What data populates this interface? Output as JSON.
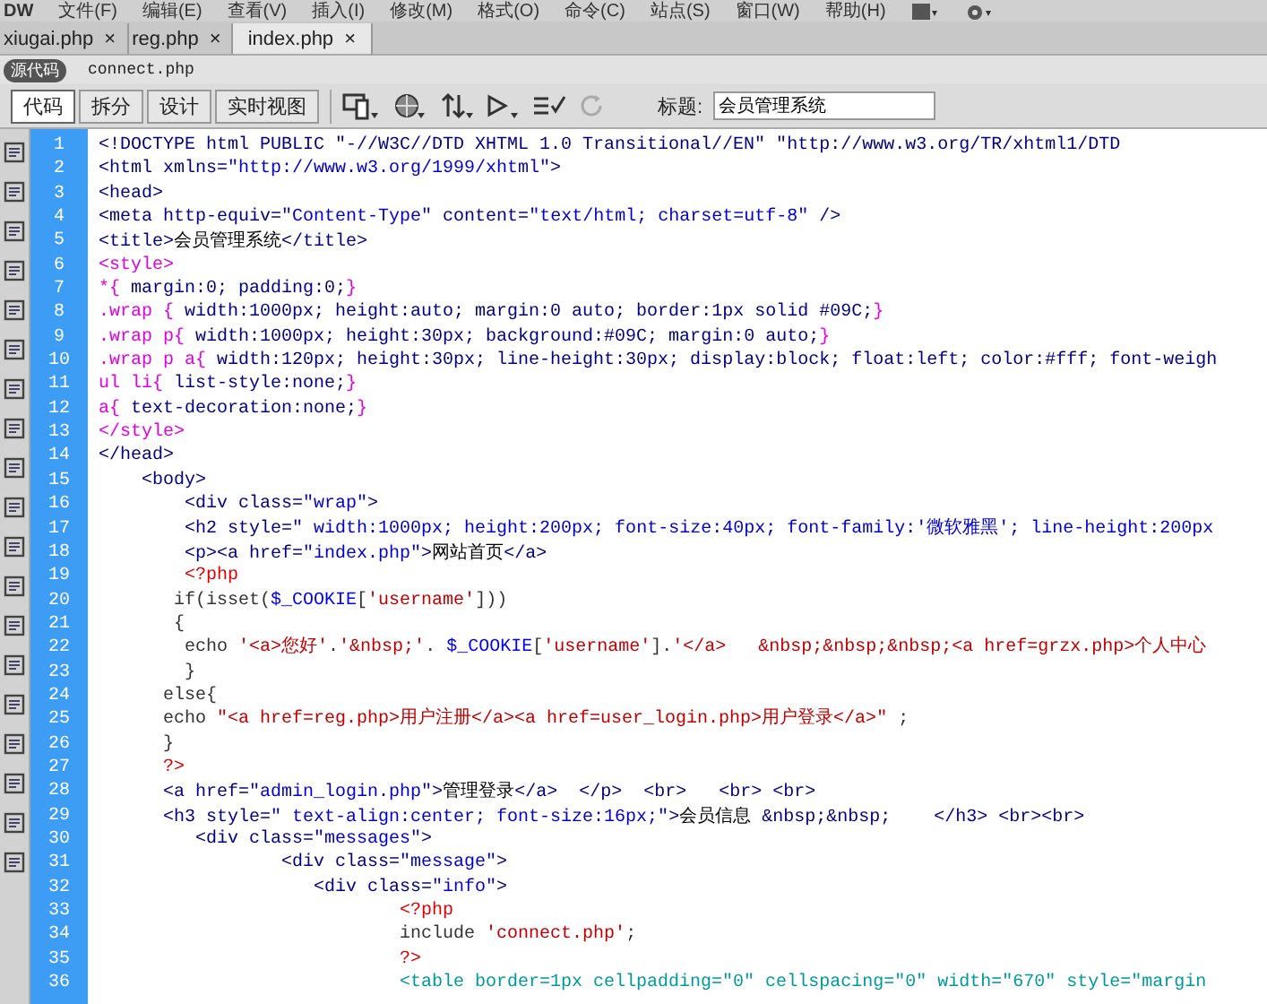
{
  "menu_bar": {
    "logo": "DW",
    "items": [
      "文件(F)",
      "编辑(E)",
      "查看(V)",
      "插入(I)",
      "修改(M)",
      "格式(O)",
      "命令(C)",
      "站点(S)",
      "窗口(W)",
      "帮助(H)"
    ]
  },
  "tabs": [
    {
      "label": "xiugai.php",
      "close": "×",
      "selected": false
    },
    {
      "label": "reg.php",
      "close": "×",
      "selected": false
    },
    {
      "label": "index.php",
      "close": "×",
      "selected": true
    }
  ],
  "related_files": [
    {
      "label": "源代码",
      "selected": true
    },
    {
      "label": "connect.php",
      "selected": false
    }
  ],
  "toolbar": {
    "views": [
      {
        "label": "代码",
        "selected": true
      },
      {
        "label": "拆分",
        "selected": false
      },
      {
        "label": "设计",
        "selected": false
      },
      {
        "label": "实时视图",
        "selected": false
      }
    ],
    "title_label": "标题:",
    "title_value": "会员管理系统"
  },
  "code": [
    {
      "number": "1",
      "segments": [
        {
          "kind": "tag",
          "text": "<!DOCTYPE html PUBLIC \"-//W3C//DTD XHTML 1.0 Transitional//EN\" \"http://www.w3.org/TR/xhtml1/DTD"
        }
      ]
    },
    {
      "number": "2",
      "segments": [
        {
          "kind": "tag",
          "text": "<html xmlns="
        },
        {
          "kind": "value",
          "text": "\"http://www.w3.org/1999/xhtml\""
        },
        {
          "kind": "tag",
          "text": ">"
        }
      ]
    },
    {
      "number": "3",
      "segments": [
        {
          "kind": "tag",
          "text": "<head>"
        }
      ]
    },
    {
      "number": "4",
      "segments": [
        {
          "kind": "tag",
          "text": "<meta http-equiv="
        },
        {
          "kind": "value",
          "text": "\"Content-Type\""
        },
        {
          "kind": "tag",
          "text": " content="
        },
        {
          "kind": "value",
          "text": "\"text/html; charset=utf-8\""
        },
        {
          "kind": "tag",
          "text": " />"
        }
      ]
    },
    {
      "number": "5",
      "segments": [
        {
          "kind": "tag",
          "text": "<title>"
        },
        {
          "kind": "text",
          "text": "会员管理系统"
        },
        {
          "kind": "tag",
          "text": "</title>"
        }
      ]
    },
    {
      "number": "6",
      "segments": [
        {
          "kind": "selector",
          "text": "<style>"
        }
      ]
    },
    {
      "number": "7",
      "segments": [
        {
          "kind": "selector",
          "text": "*{"
        },
        {
          "kind": "css",
          "text": " margin:0; padding:0;"
        },
        {
          "kind": "selector",
          "text": "}"
        }
      ]
    },
    {
      "number": "8",
      "segments": [
        {
          "kind": "selector",
          "text": ".wrap {"
        },
        {
          "kind": "css",
          "text": " width:1000px; height:auto; margin:0 auto; border:1px solid #09C;"
        },
        {
          "kind": "selector",
          "text": "}"
        }
      ]
    },
    {
      "number": "9",
      "segments": [
        {
          "kind": "selector",
          "text": ".wrap p{"
        },
        {
          "kind": "css",
          "text": " width:1000px; height:30px; background:#09C; margin:0 auto;"
        },
        {
          "kind": "selector",
          "text": "}"
        }
      ]
    },
    {
      "number": "10",
      "segments": [
        {
          "kind": "selector",
          "text": ".wrap p a{"
        },
        {
          "kind": "css",
          "text": " width:120px; height:30px; line-height:30px; display:block; float:left; color:#fff; font-weigh"
        }
      ]
    },
    {
      "number": "11",
      "segments": [
        {
          "kind": "selector",
          "text": "ul li{"
        },
        {
          "kind": "css",
          "text": " list-style:none;"
        },
        {
          "kind": "selector",
          "text": "}"
        }
      ]
    },
    {
      "number": "12",
      "segments": [
        {
          "kind": "selector",
          "text": "a{"
        },
        {
          "kind": "css",
          "text": " text-decoration:none;"
        },
        {
          "kind": "selector",
          "text": "}"
        }
      ]
    },
    {
      "number": "13",
      "segments": [
        {
          "kind": "selector",
          "text": "</style>"
        }
      ]
    },
    {
      "number": "14",
      "segments": [
        {
          "kind": "tag",
          "text": "</head>"
        }
      ]
    },
    {
      "number": "15",
      "segments": [
        {
          "kind": "tag",
          "text": "    <body>"
        }
      ]
    },
    {
      "number": "16",
      "segments": [
        {
          "kind": "tag",
          "text": "        <div class="
        },
        {
          "kind": "value",
          "text": "\"wrap\""
        },
        {
          "kind": "tag",
          "text": ">"
        }
      ]
    },
    {
      "number": "17",
      "segments": [
        {
          "kind": "tag",
          "text": "        <h2 style="
        },
        {
          "kind": "value",
          "text": "\" width:1000px; height:200px; font-size:40px; font-family:'微软雅黑'; line-height:200px"
        }
      ]
    },
    {
      "number": "18",
      "segments": [
        {
          "kind": "tag",
          "text": "        <p><a href="
        },
        {
          "kind": "value",
          "text": "\"index.php\""
        },
        {
          "kind": "tag",
          "text": ">"
        },
        {
          "kind": "text",
          "text": "网站首页"
        },
        {
          "kind": "tag",
          "text": "</a>"
        }
      ]
    },
    {
      "number": "19",
      "segments": [
        {
          "kind": "php",
          "text": "        <?php"
        }
      ]
    },
    {
      "number": "20",
      "segments": [
        {
          "kind": "code",
          "text": "       if(isset("
        },
        {
          "kind": "var",
          "text": "$_COOKIE"
        },
        {
          "kind": "code",
          "text": "["
        },
        {
          "kind": "string",
          "text": "'username'"
        },
        {
          "kind": "code",
          "text": "]))"
        }
      ]
    },
    {
      "number": "21",
      "segments": [
        {
          "kind": "code",
          "text": "       {"
        }
      ]
    },
    {
      "number": "22",
      "segments": [
        {
          "kind": "code",
          "text": "        echo "
        },
        {
          "kind": "string",
          "text": "'<a>您好'"
        },
        {
          "kind": "code",
          "text": "."
        },
        {
          "kind": "string",
          "text": "'&nbsp;'"
        },
        {
          "kind": "code",
          "text": ". "
        },
        {
          "kind": "var",
          "text": "$_COOKIE"
        },
        {
          "kind": "code",
          "text": "["
        },
        {
          "kind": "string",
          "text": "'username'"
        },
        {
          "kind": "code",
          "text": "]."
        },
        {
          "kind": "string",
          "text": "'</a>   &nbsp;&nbsp;&nbsp;<a href=grzx.php>个人中心"
        }
      ]
    },
    {
      "number": "23",
      "segments": [
        {
          "kind": "code",
          "text": "        }"
        }
      ]
    },
    {
      "number": "24",
      "segments": [
        {
          "kind": "code",
          "text": "      else{"
        }
      ]
    },
    {
      "number": "25",
      "segments": [
        {
          "kind": "code",
          "text": "      echo "
        },
        {
          "kind": "string",
          "text": "\"<a href=reg.php>用户注册</a><a href=user_login.php>用户登录</a>\""
        },
        {
          "kind": "code",
          "text": " ;"
        }
      ]
    },
    {
      "number": "26",
      "segments": [
        {
          "kind": "code",
          "text": "      }"
        }
      ]
    },
    {
      "number": "27",
      "segments": [
        {
          "kind": "php",
          "text": "      ?>"
        }
      ]
    },
    {
      "number": "28",
      "segments": [
        {
          "kind": "tag",
          "text": "      <a href="
        },
        {
          "kind": "value",
          "text": "\"admin_login.php\""
        },
        {
          "kind": "tag",
          "text": ">"
        },
        {
          "kind": "text",
          "text": "管理登录"
        },
        {
          "kind": "tag",
          "text": "</a>  </p>  <br>   <br> <br>"
        }
      ]
    },
    {
      "number": "29",
      "segments": [
        {
          "kind": "tag",
          "text": "      <h3 style="
        },
        {
          "kind": "value",
          "text": "\" text-align:center; font-size:16px;\""
        },
        {
          "kind": "tag",
          "text": ">"
        },
        {
          "kind": "text",
          "text": "会员信息"
        },
        {
          "kind": "tag",
          "text": " &nbsp;&nbsp;    </h3> <br><br>"
        }
      ]
    },
    {
      "number": "30",
      "segments": [
        {
          "kind": "tag",
          "text": "         <div class="
        },
        {
          "kind": "value",
          "text": "\"messages\""
        },
        {
          "kind": "tag",
          "text": ">"
        }
      ]
    },
    {
      "number": "31",
      "segments": [
        {
          "kind": "tag",
          "text": "                 <div class="
        },
        {
          "kind": "value",
          "text": "\"message\""
        },
        {
          "kind": "tag",
          "text": ">"
        }
      ]
    },
    {
      "number": "32",
      "segments": [
        {
          "kind": "tag",
          "text": "                    <div class="
        },
        {
          "kind": "value",
          "text": "\"info\""
        },
        {
          "kind": "tag",
          "text": ">"
        }
      ]
    },
    {
      "number": "33",
      "segments": [
        {
          "kind": "php",
          "text": "                            <?php"
        }
      ]
    },
    {
      "number": "34",
      "segments": [
        {
          "kind": "code",
          "text": "                            include "
        },
        {
          "kind": "string",
          "text": "'connect.php'"
        },
        {
          "kind": "code",
          "text": ";"
        }
      ]
    },
    {
      "number": "35",
      "segments": [
        {
          "kind": "php",
          "text": "                            ?>"
        }
      ]
    },
    {
      "number": "36",
      "segments": [
        {
          "kind": "table",
          "text": "                            <table border=1px cellpadding=\"0\" cellspacing=\"0\" width=\"670\" style=\"margin"
        }
      ]
    }
  ]
}
